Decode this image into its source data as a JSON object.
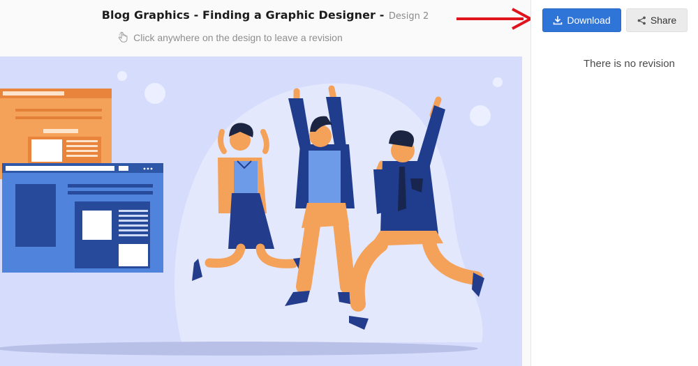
{
  "header": {
    "title": "Blog Graphics - Finding a Graphic Designer -",
    "subtitle": "Design 2",
    "hint": "Click anywhere on the design to leave a revision",
    "hint_icon": "pointer-hand-icon"
  },
  "actions": {
    "download_label": "Download",
    "download_icon": "download-icon",
    "share_label": "Share",
    "share_icon": "share-icon"
  },
  "sidebar": {
    "empty_message": "There is no revision"
  },
  "colors": {
    "primary_button": "#2f75d8",
    "secondary_button": "#ebebeb",
    "annotation_arrow": "#e0141c",
    "canvas_background": "#d6dcfb"
  },
  "design": {
    "illustration": "three people jumping celebrating beside website windows",
    "annotation": "red-arrow-pointing-to-download"
  }
}
